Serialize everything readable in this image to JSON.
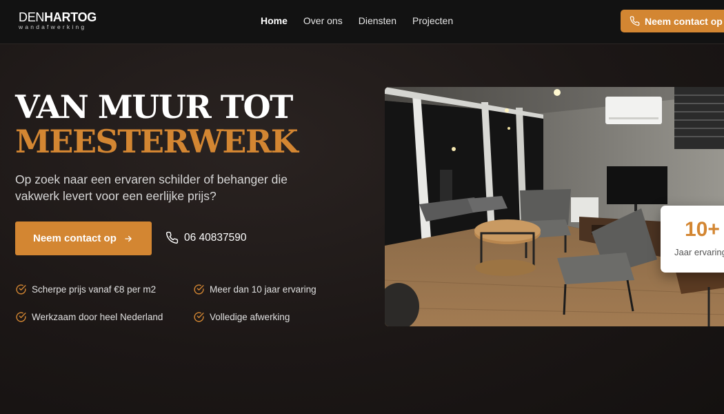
{
  "header": {
    "logo_den": "DEN",
    "logo_hartog": "HARTOG",
    "logo_sub": "wandafwerking",
    "nav": [
      {
        "label": "Home"
      },
      {
        "label": "Over ons"
      },
      {
        "label": "Diensten"
      },
      {
        "label": "Projecten"
      }
    ],
    "contact_button": "Neem contact op"
  },
  "hero": {
    "title_line1": "VAN MUUR TOT",
    "title_line2": "MEESTERWERK",
    "subtitle": "Op zoek naar een ervaren schilder of behanger die vakwerk levert voor een eerlijke prijs?",
    "cta_label": "Neem contact op",
    "phone": "06 40837590",
    "features": [
      {
        "label": "Scherpe prijs vanaf €8 per m2"
      },
      {
        "label": "Meer dan 10 jaar ervaring"
      },
      {
        "label": "Werkzaam door heel Nederland"
      },
      {
        "label": "Volledige afwerking"
      }
    ]
  },
  "stat": {
    "number": "10+",
    "label": "Jaar ervaring"
  },
  "colors": {
    "accent": "#d38632",
    "background": "#1c1716",
    "header": "#121212"
  },
  "icons": {
    "phone": "phone-icon",
    "arrow": "arrow-right-icon",
    "check": "check-circle-icon"
  }
}
